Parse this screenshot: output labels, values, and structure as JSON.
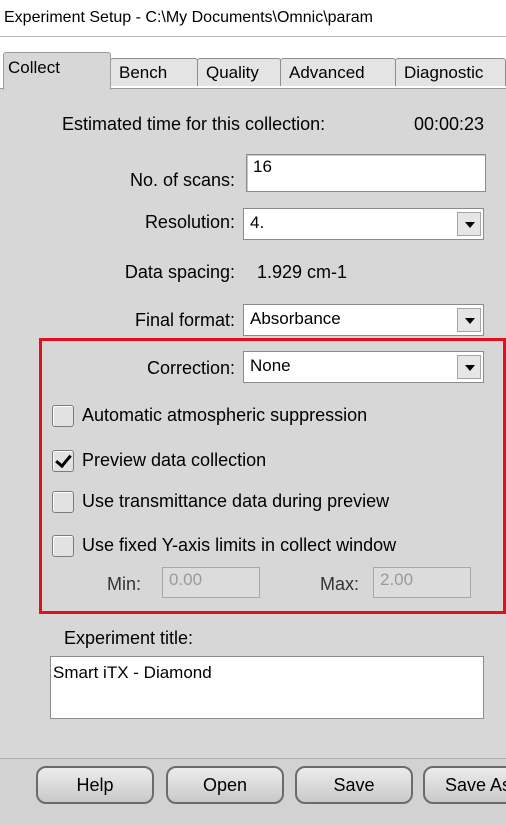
{
  "window": {
    "title": "Experiment Setup - C:\\My Documents\\Omnic\\param"
  },
  "tabs": [
    {
      "label": "Collect"
    },
    {
      "label": "Bench"
    },
    {
      "label": "Quality"
    },
    {
      "label": "Advanced"
    },
    {
      "label": "Diagnostic"
    }
  ],
  "collect": {
    "estimated_time_label": "Estimated time for this collection:",
    "estimated_time_value": "00:00:23",
    "scans_label": "No. of scans:",
    "scans_value": "16",
    "resolution_label": "Resolution:",
    "resolution_value": "4.",
    "data_spacing_label": "Data spacing:",
    "data_spacing_value": "1.929 cm-1",
    "final_format_label": "Final format:",
    "final_format_value": "Absorbance",
    "correction_label": "Correction:",
    "correction_value": "None",
    "checkboxes": [
      {
        "label": "Automatic atmospheric suppression",
        "checked": false
      },
      {
        "label": "Preview data collection",
        "checked": true
      },
      {
        "label": "Use transmittance data during preview",
        "checked": false
      },
      {
        "label": "Use fixed Y-axis limits in collect window",
        "checked": false
      }
    ],
    "min_label": "Min:",
    "min_value": "0.00",
    "max_label": "Max:",
    "max_value": "2.00",
    "experiment_title_label": "Experiment title:",
    "experiment_title_value": "Smart iTX - Diamond"
  },
  "buttons": {
    "help": "Help",
    "open": "Open",
    "save": "Save",
    "save_as": "Save As"
  },
  "colors": {
    "highlight": "#e0101c",
    "panel": "#d7d7d7"
  }
}
